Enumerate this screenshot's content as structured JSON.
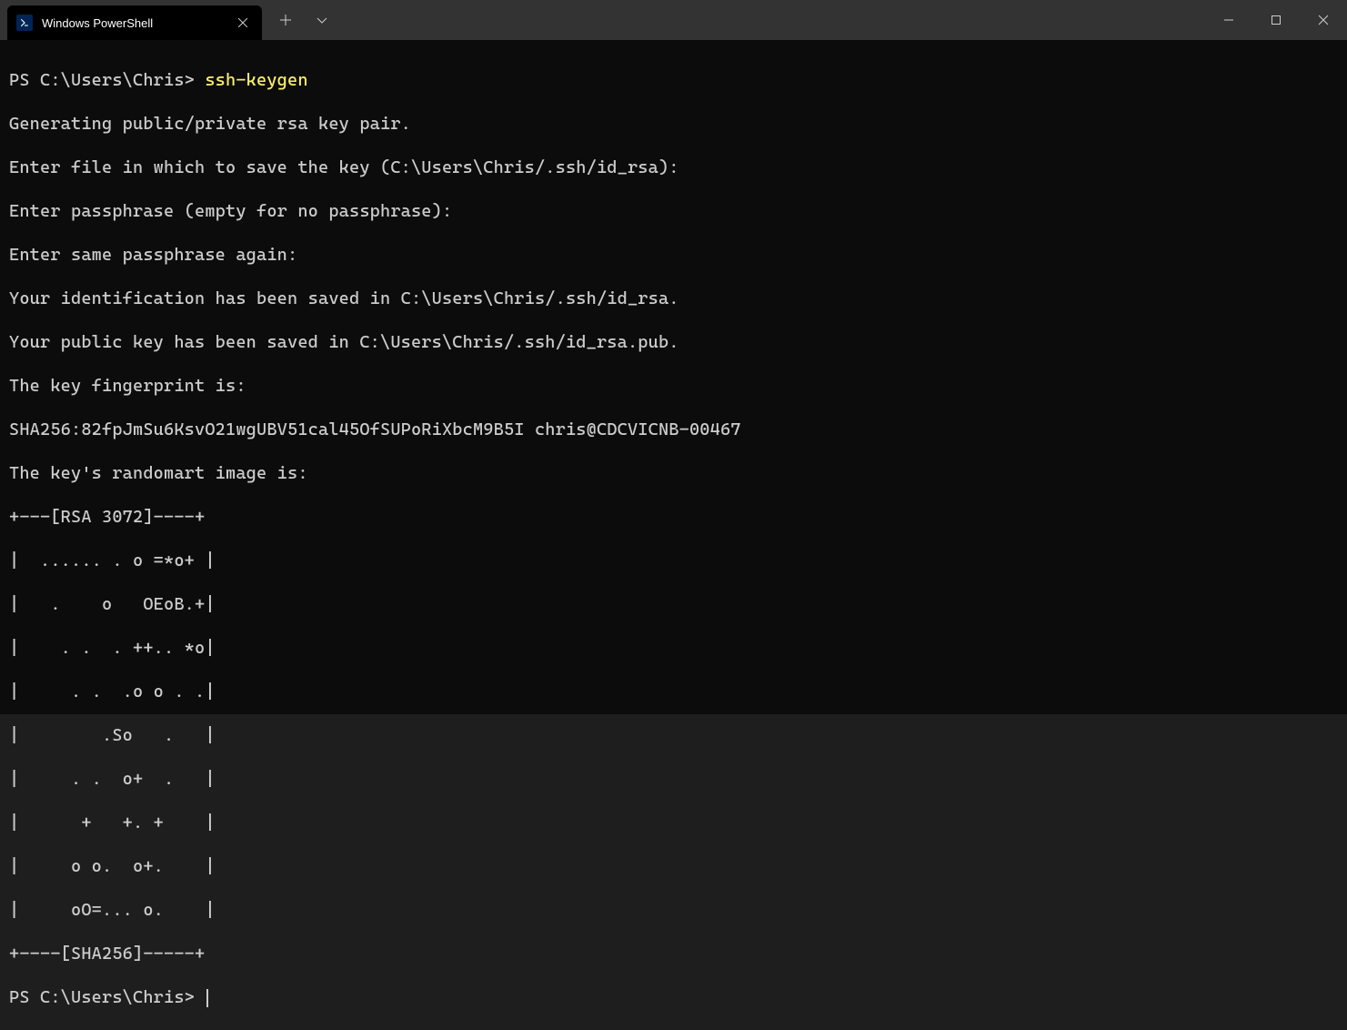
{
  "titlebar": {
    "tab": {
      "title": "Windows PowerShell"
    }
  },
  "terminal": {
    "prompt1": "PS C:\\Users\\Chris> ",
    "command1": "ssh-keygen",
    "lines": [
      "Generating public/private rsa key pair.",
      "Enter file in which to save the key (C:\\Users\\Chris/.ssh/id_rsa):",
      "Enter passphrase (empty for no passphrase):",
      "Enter same passphrase again:",
      "Your identification has been saved in C:\\Users\\Chris/.ssh/id_rsa.",
      "Your public key has been saved in C:\\Users\\Chris/.ssh/id_rsa.pub.",
      "The key fingerprint is:",
      "SHA256:82fpJmSu6KsvO21wgUBV51cal45OfSUPoRiXbcM9B5I chris@CDCVICNB-00467",
      "The key's randomart image is:",
      "+---[RSA 3072]----+",
      "|  ...... . o =*o+ |",
      "|   .    o   OEoB.+|",
      "|    . .  . ++.. *o|",
      "|     . .  .o o . .|",
      "|        .So   .   |",
      "|     . .  o+  .   |",
      "|      +   +. +    |",
      "|     o o.  o+.    |",
      "|     oO=... o.    |",
      "+----[SHA256]-----+"
    ],
    "prompt2": "PS C:\\Users\\Chris> "
  }
}
